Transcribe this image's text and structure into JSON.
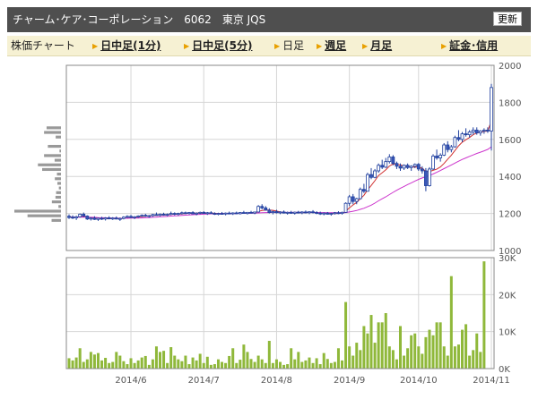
{
  "header": {
    "title": "チャーム･ケア･コーポレーション　6062　東京 JQS",
    "refresh_label": "更新"
  },
  "nav": {
    "label": "株価チャート",
    "items": [
      {
        "label": "日中足(1分)",
        "link": true
      },
      {
        "label": "日中足(5分)",
        "link": true
      },
      {
        "label": "日足",
        "link": false
      },
      {
        "label": "週足",
        "link": true
      },
      {
        "label": "月足",
        "link": true
      },
      {
        "label": "証金･信用",
        "link": true
      }
    ]
  },
  "colors": {
    "up": "#1f3f9e",
    "down": "#3a57b8",
    "ma_short": "#d03030",
    "ma_long": "#cc33cc",
    "volume": "#8fb83a",
    "profile": "#999999",
    "grid": "#d6d6d6",
    "border": "#888888"
  },
  "chart_data": [
    {
      "type": "candlestick",
      "title": "",
      "ylim": [
        1000,
        2000
      ],
      "yticks": [
        1000,
        1200,
        1400,
        1600,
        1800,
        2000
      ],
      "x_labels": [
        "2014/6",
        "2014/7",
        "2014/8",
        "2014/9",
        "2014/10",
        "2014/11"
      ],
      "x_label_index": [
        17,
        37,
        57,
        77,
        96,
        116
      ],
      "grid": true,
      "ohlc": [
        [
          1185,
          1195,
          1170,
          1178
        ],
        [
          1180,
          1190,
          1170,
          1176
        ],
        [
          1176,
          1188,
          1165,
          1182
        ],
        [
          1182,
          1200,
          1178,
          1196
        ],
        [
          1196,
          1205,
          1180,
          1186
        ],
        [
          1186,
          1190,
          1165,
          1170
        ],
        [
          1170,
          1180,
          1162,
          1175
        ],
        [
          1175,
          1185,
          1165,
          1168
        ],
        [
          1168,
          1178,
          1160,
          1174
        ],
        [
          1174,
          1182,
          1165,
          1170
        ],
        [
          1170,
          1180,
          1162,
          1176
        ],
        [
          1176,
          1185,
          1168,
          1172
        ],
        [
          1172,
          1180,
          1165,
          1175
        ],
        [
          1175,
          1184,
          1168,
          1170
        ],
        [
          1170,
          1178,
          1160,
          1173
        ],
        [
          1173,
          1185,
          1168,
          1180
        ],
        [
          1180,
          1190,
          1175,
          1184
        ],
        [
          1184,
          1192,
          1175,
          1178
        ],
        [
          1178,
          1186,
          1170,
          1182
        ],
        [
          1182,
          1190,
          1176,
          1186
        ],
        [
          1186,
          1195,
          1180,
          1190
        ],
        [
          1190,
          1198,
          1182,
          1186
        ],
        [
          1186,
          1192,
          1178,
          1188
        ],
        [
          1188,
          1198,
          1182,
          1194
        ],
        [
          1194,
          1205,
          1188,
          1190
        ],
        [
          1190,
          1200,
          1184,
          1196
        ],
        [
          1196,
          1204,
          1188,
          1192
        ],
        [
          1192,
          1200,
          1185,
          1195
        ],
        [
          1195,
          1210,
          1190,
          1200
        ],
        [
          1200,
          1206,
          1190,
          1196
        ],
        [
          1196,
          1204,
          1188,
          1200
        ],
        [
          1200,
          1210,
          1194,
          1204
        ],
        [
          1204,
          1210,
          1196,
          1200
        ],
        [
          1200,
          1208,
          1194,
          1205
        ],
        [
          1205,
          1212,
          1196,
          1198
        ],
        [
          1198,
          1206,
          1190,
          1202
        ],
        [
          1202,
          1210,
          1196,
          1206
        ],
        [
          1206,
          1212,
          1198,
          1200
        ],
        [
          1200,
          1208,
          1192,
          1204
        ],
        [
          1204,
          1212,
          1198,
          1200
        ],
        [
          1200,
          1206,
          1192,
          1196
        ],
        [
          1196,
          1204,
          1190,
          1200
        ],
        [
          1200,
          1208,
          1194,
          1197
        ],
        [
          1197,
          1205,
          1190,
          1202
        ],
        [
          1202,
          1210,
          1196,
          1198
        ],
        [
          1198,
          1206,
          1192,
          1203
        ],
        [
          1203,
          1210,
          1196,
          1199
        ],
        [
          1199,
          1208,
          1194,
          1205
        ],
        [
          1205,
          1214,
          1198,
          1200
        ],
        [
          1200,
          1208,
          1194,
          1206
        ],
        [
          1206,
          1214,
          1200,
          1202
        ],
        [
          1202,
          1210,
          1196,
          1208
        ],
        [
          1208,
          1245,
          1205,
          1238
        ],
        [
          1238,
          1250,
          1222,
          1230
        ],
        [
          1230,
          1240,
          1215,
          1218
        ],
        [
          1218,
          1228,
          1200,
          1205
        ],
        [
          1205,
          1215,
          1195,
          1210
        ],
        [
          1210,
          1220,
          1200,
          1204
        ],
        [
          1204,
          1212,
          1196,
          1208
        ],
        [
          1208,
          1216,
          1200,
          1202
        ],
        [
          1202,
          1210,
          1194,
          1206
        ],
        [
          1206,
          1214,
          1198,
          1201
        ],
        [
          1201,
          1210,
          1194,
          1207
        ],
        [
          1207,
          1214,
          1200,
          1203
        ],
        [
          1203,
          1212,
          1196,
          1208
        ],
        [
          1208,
          1216,
          1200,
          1204
        ],
        [
          1204,
          1212,
          1196,
          1209
        ],
        [
          1209,
          1218,
          1200,
          1205
        ],
        [
          1205,
          1212,
          1196,
          1202
        ],
        [
          1202,
          1210,
          1192,
          1198
        ],
        [
          1198,
          1206,
          1190,
          1202
        ],
        [
          1202,
          1208,
          1194,
          1196
        ],
        [
          1196,
          1204,
          1188,
          1200
        ],
        [
          1200,
          1208,
          1194,
          1204
        ],
        [
          1204,
          1212,
          1196,
          1200
        ],
        [
          1200,
          1210,
          1194,
          1206
        ],
        [
          1206,
          1260,
          1204,
          1255
        ],
        [
          1255,
          1300,
          1240,
          1290
        ],
        [
          1290,
          1305,
          1250,
          1265
        ],
        [
          1265,
          1285,
          1250,
          1280
        ],
        [
          1280,
          1340,
          1275,
          1330
        ],
        [
          1330,
          1360,
          1310,
          1320
        ],
        [
          1320,
          1420,
          1318,
          1410
        ],
        [
          1410,
          1445,
          1385,
          1395
        ],
        [
          1395,
          1440,
          1390,
          1430
        ],
        [
          1430,
          1470,
          1420,
          1460
        ],
        [
          1460,
          1490,
          1440,
          1450
        ],
        [
          1450,
          1500,
          1445,
          1480
        ],
        [
          1480,
          1520,
          1470,
          1505
        ],
        [
          1505,
          1515,
          1460,
          1470
        ],
        [
          1470,
          1480,
          1440,
          1455
        ],
        [
          1455,
          1470,
          1430,
          1445
        ],
        [
          1445,
          1465,
          1435,
          1460
        ],
        [
          1460,
          1470,
          1440,
          1448
        ],
        [
          1448,
          1460,
          1430,
          1455
        ],
        [
          1455,
          1470,
          1445,
          1465
        ],
        [
          1465,
          1472,
          1430,
          1440
        ],
        [
          1440,
          1455,
          1415,
          1430
        ],
        [
          1430,
          1445,
          1320,
          1350
        ],
        [
          1350,
          1450,
          1345,
          1440
        ],
        [
          1440,
          1520,
          1435,
          1510
        ],
        [
          1510,
          1545,
          1490,
          1500
        ],
        [
          1500,
          1525,
          1480,
          1515
        ],
        [
          1515,
          1580,
          1510,
          1570
        ],
        [
          1570,
          1590,
          1530,
          1545
        ],
        [
          1545,
          1570,
          1530,
          1560
        ],
        [
          1560,
          1620,
          1555,
          1610
        ],
        [
          1610,
          1650,
          1590,
          1600
        ],
        [
          1600,
          1640,
          1585,
          1630
        ],
        [
          1630,
          1660,
          1615,
          1625
        ],
        [
          1625,
          1650,
          1610,
          1640
        ],
        [
          1640,
          1665,
          1625,
          1650
        ],
        [
          1650,
          1665,
          1625,
          1635
        ],
        [
          1635,
          1650,
          1620,
          1645
        ],
        [
          1645,
          1660,
          1630,
          1650
        ],
        [
          1650,
          1665,
          1635,
          1645
        ],
        [
          1645,
          1900,
          1540,
          1880
        ]
      ],
      "moving_averages": [
        {
          "values": [
            1182,
            1180,
            1179,
            1182,
            1184,
            1180,
            1178,
            1176,
            1174,
            1173,
            1172,
            1172,
            1173,
            1172,
            1172,
            1174,
            1176,
            1177,
            1178,
            1180,
            1183,
            1185,
            1187,
            1189,
            1190,
            1191,
            1192,
            1193,
            1195,
            1196,
            1196,
            1198,
            1200,
            1201,
            1201,
            1202,
            1203,
            1202,
            1202,
            1202,
            1201,
            1200,
            1200,
            1200,
            1200,
            1200,
            1200,
            1201,
            1201,
            1202,
            1203,
            1204,
            1211,
            1216,
            1219,
            1219,
            1217,
            1213,
            1208,
            1206,
            1205,
            1205,
            1205,
            1205,
            1205,
            1205,
            1206,
            1206,
            1205,
            1203,
            1202,
            1201,
            1199,
            1200,
            1200,
            1201,
            1212,
            1230,
            1246,
            1260,
            1279,
            1298,
            1327,
            1351,
            1377,
            1405,
            1420,
            1436,
            1456,
            1467,
            1466,
            1462,
            1457,
            1453,
            1450,
            1451,
            1450,
            1444,
            1427,
            1426,
            1433,
            1439,
            1451,
            1470,
            1493,
            1514,
            1540,
            1565,
            1585,
            1598,
            1610,
            1625,
            1635,
            1640,
            1643,
            1645,
            1700
          ]
        },
        {
          "values": [
            1180,
            1180,
            1180,
            1180,
            1180,
            1180,
            1179,
            1179,
            1178,
            1177,
            1177,
            1176,
            1175,
            1175,
            1174,
            1174,
            1174,
            1175,
            1175,
            1175,
            1176,
            1177,
            1178,
            1179,
            1180,
            1182,
            1183,
            1184,
            1186,
            1187,
            1188,
            1190,
            1191,
            1192,
            1193,
            1194,
            1195,
            1196,
            1197,
            1198,
            1198,
            1199,
            1199,
            1200,
            1200,
            1200,
            1200,
            1201,
            1201,
            1201,
            1202,
            1202,
            1203,
            1204,
            1205,
            1205,
            1206,
            1206,
            1206,
            1206,
            1206,
            1206,
            1206,
            1206,
            1206,
            1206,
            1206,
            1206,
            1205,
            1205,
            1205,
            1204,
            1204,
            1204,
            1204,
            1204,
            1205,
            1208,
            1212,
            1216,
            1222,
            1228,
            1236,
            1245,
            1256,
            1268,
            1279,
            1290,
            1302,
            1314,
            1325,
            1336,
            1346,
            1356,
            1365,
            1375,
            1384,
            1392,
            1398,
            1405,
            1413,
            1422,
            1432,
            1442,
            1452,
            1462,
            1472,
            1482,
            1492,
            1500,
            1508,
            1516,
            1524,
            1531,
            1538,
            1546,
            1560
          ]
        }
      ]
    },
    {
      "type": "bar",
      "title": "",
      "ylim": [
        0,
        30000
      ],
      "yticks": [
        0,
        10000,
        20000,
        30000
      ],
      "ytick_labels": [
        "0K",
        "10K",
        "20K",
        "30K"
      ],
      "values": [
        2800,
        2200,
        3000,
        5500,
        1800,
        2500,
        4500,
        3800,
        4200,
        2200,
        2900,
        1500,
        1800,
        4500,
        3500,
        2000,
        1200,
        2800,
        1500,
        2200,
        3000,
        3400,
        1000,
        2500,
        6000,
        4500,
        4800,
        1500,
        5800,
        3500,
        2500,
        2000,
        3500,
        1200,
        3000,
        2200,
        4000,
        1500,
        3200,
        1000,
        1200,
        2500,
        1800,
        1500,
        3400,
        5500,
        1500,
        2400,
        6500,
        4500,
        2600,
        1800,
        3500,
        2500,
        1500,
        7500,
        1500,
        2500,
        1800,
        1000,
        1200,
        5500,
        2500,
        4500,
        1800,
        2200,
        3000,
        1500,
        2800,
        1200,
        4200,
        2600,
        1500,
        1800,
        5500,
        2200,
        18000,
        6000,
        3500,
        7000,
        5000,
        11500,
        9500,
        14500,
        7000,
        12500,
        12500,
        15000,
        6000,
        5000,
        2500,
        11500,
        3500,
        5500,
        9000,
        9500,
        6000,
        4000,
        8500,
        10500,
        9000,
        12500,
        12500,
        6000,
        3500,
        25000,
        6000,
        6500,
        10500,
        12000,
        3500,
        5000,
        9500,
        4500,
        29000
      ]
    }
  ]
}
